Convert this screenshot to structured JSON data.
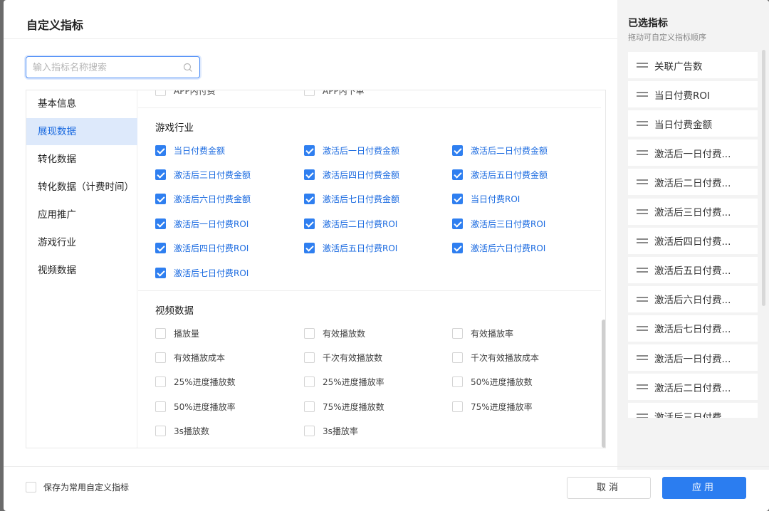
{
  "dialog": {
    "title": "自定义指标"
  },
  "search": {
    "placeholder": "输入指标名称搜索"
  },
  "nav": {
    "items": [
      {
        "label": "基本信息",
        "active": false
      },
      {
        "label": "展现数据",
        "active": true
      },
      {
        "label": "转化数据",
        "active": false
      },
      {
        "label": "转化数据（计费时间）",
        "active": false
      },
      {
        "label": "应用推广",
        "active": false
      },
      {
        "label": "游戏行业",
        "active": false
      },
      {
        "label": "视频数据",
        "active": false
      }
    ]
  },
  "cut_row": [
    "APP内付费",
    "APP内下单"
  ],
  "sections": [
    {
      "title": "游戏行业",
      "items": [
        {
          "label": "当日付费金额",
          "checked": true
        },
        {
          "label": "激活后一日付费金额",
          "checked": true
        },
        {
          "label": "激活后二日付费金额",
          "checked": true
        },
        {
          "label": "激活后三日付费金额",
          "checked": true
        },
        {
          "label": "激活后四日付费金额",
          "checked": true
        },
        {
          "label": "激活后五日付费金额",
          "checked": true
        },
        {
          "label": "激活后六日付费金额",
          "checked": true
        },
        {
          "label": "激活后七日付费金额",
          "checked": true
        },
        {
          "label": "当日付费ROI",
          "checked": true
        },
        {
          "label": "激活后一日付费ROI",
          "checked": true
        },
        {
          "label": "激活后二日付费ROI",
          "checked": true
        },
        {
          "label": "激活后三日付费ROI",
          "checked": true
        },
        {
          "label": "激活后四日付费ROI",
          "checked": true
        },
        {
          "label": "激活后五日付费ROI",
          "checked": true
        },
        {
          "label": "激活后六日付费ROI",
          "checked": true
        },
        {
          "label": "激活后七日付费ROI",
          "checked": true
        }
      ]
    },
    {
      "title": "视频数据",
      "items": [
        {
          "label": "播放量",
          "checked": false
        },
        {
          "label": "有效播放数",
          "checked": false
        },
        {
          "label": "有效播放率",
          "checked": false
        },
        {
          "label": "有效播放成本",
          "checked": false
        },
        {
          "label": "千次有效播放数",
          "checked": false
        },
        {
          "label": "千次有效播放成本",
          "checked": false
        },
        {
          "label": "25%进度播放数",
          "checked": false
        },
        {
          "label": "25%进度播放率",
          "checked": false
        },
        {
          "label": "50%进度播放数",
          "checked": false
        },
        {
          "label": "50%进度播放率",
          "checked": false
        },
        {
          "label": "75%进度播放数",
          "checked": false
        },
        {
          "label": "75%进度播放率",
          "checked": false
        },
        {
          "label": "3s播放数",
          "checked": false
        },
        {
          "label": "3s播放率",
          "checked": false
        }
      ]
    }
  ],
  "selected": {
    "title": "已选指标",
    "subtitle": "拖动可自定义指标顺序",
    "items": [
      "关联广告数",
      "当日付费ROI",
      "当日付费金额",
      "激活后一日付费...",
      "激活后二日付费...",
      "激活后三日付费...",
      "激活后四日付费...",
      "激活后五日付费...",
      "激活后六日付费...",
      "激活后七日付费...",
      "激活后一日付费...",
      "激活后二日付费...",
      "激活后三日付费"
    ]
  },
  "footer": {
    "save_label": "保存为常用自定义指标",
    "cancel_label": "取消",
    "apply_label": "应用"
  },
  "colors": {
    "accent": "#2b7df0",
    "active_nav_bg": "#dde9fb"
  },
  "icons": {
    "search": "search-icon",
    "drag": "drag-handle-icon",
    "check": "check-icon"
  }
}
